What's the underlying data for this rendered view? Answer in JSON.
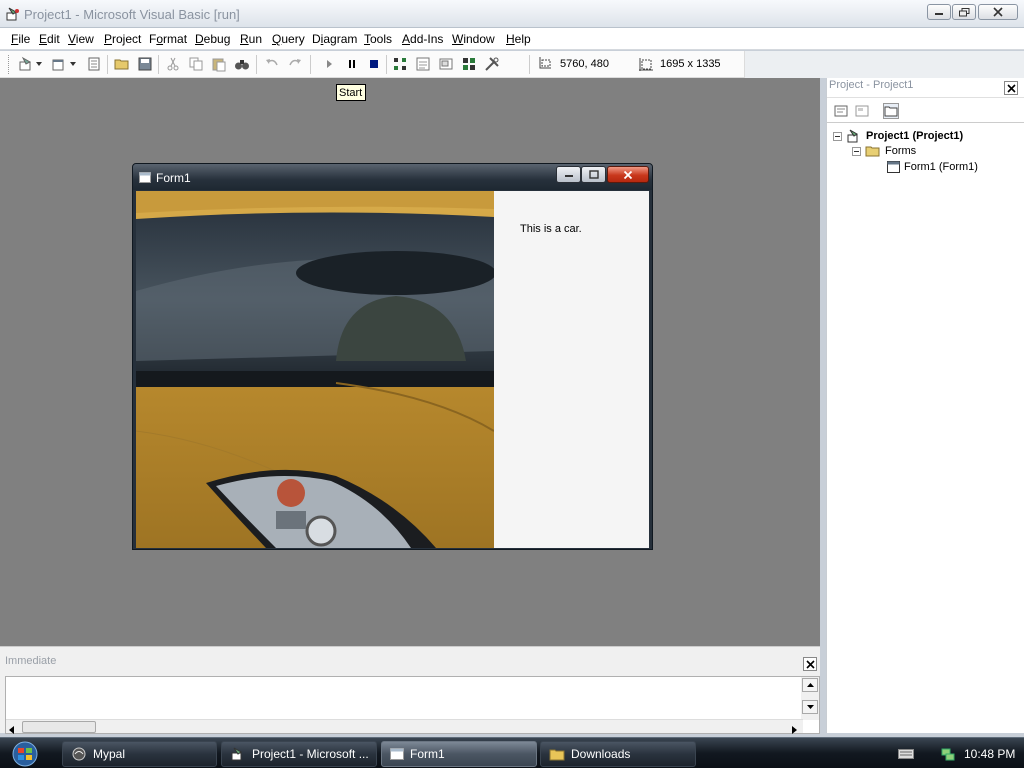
{
  "window": {
    "title": "Project1 - Microsoft Visual Basic [run]"
  },
  "menu": {
    "items": [
      {
        "label": "File",
        "accel": "F"
      },
      {
        "label": "Edit",
        "accel": "E"
      },
      {
        "label": "View",
        "accel": "V"
      },
      {
        "label": "Project",
        "accel": "P"
      },
      {
        "label": "Format",
        "accel": "o"
      },
      {
        "label": "Debug",
        "accel": "D"
      },
      {
        "label": "Run",
        "accel": "R"
      },
      {
        "label": "Query",
        "accel": "Q"
      },
      {
        "label": "Diagram",
        "accel": "i"
      },
      {
        "label": "Tools",
        "accel": "T"
      },
      {
        "label": "Add-Ins",
        "accel": "A"
      },
      {
        "label": "Window",
        "accel": "W"
      },
      {
        "label": "Help",
        "accel": "H"
      }
    ]
  },
  "toolbar": {
    "position_readout": "5760, 480",
    "size_readout": "1695 x 1335",
    "tooltip": "Start"
  },
  "form1": {
    "title": "Form1",
    "caption": "This is a car."
  },
  "project_explorer": {
    "title": "Project - Project1",
    "tree": {
      "root": "Project1 (Project1)",
      "folder": "Forms",
      "form": "Form1 (Form1)"
    }
  },
  "immediate": {
    "title": "Immediate"
  },
  "taskbar": {
    "tasks": [
      {
        "label": "Mypal"
      },
      {
        "label": "Project1 - Microsoft ..."
      },
      {
        "label": "Form1"
      },
      {
        "label": "Downloads"
      }
    ],
    "clock": "10:48 PM"
  },
  "colors": {
    "mdi_background": "#808080",
    "form_titlebar": "#27313c",
    "car_paint": "#c79a3a",
    "close_button": "#c9381d"
  }
}
